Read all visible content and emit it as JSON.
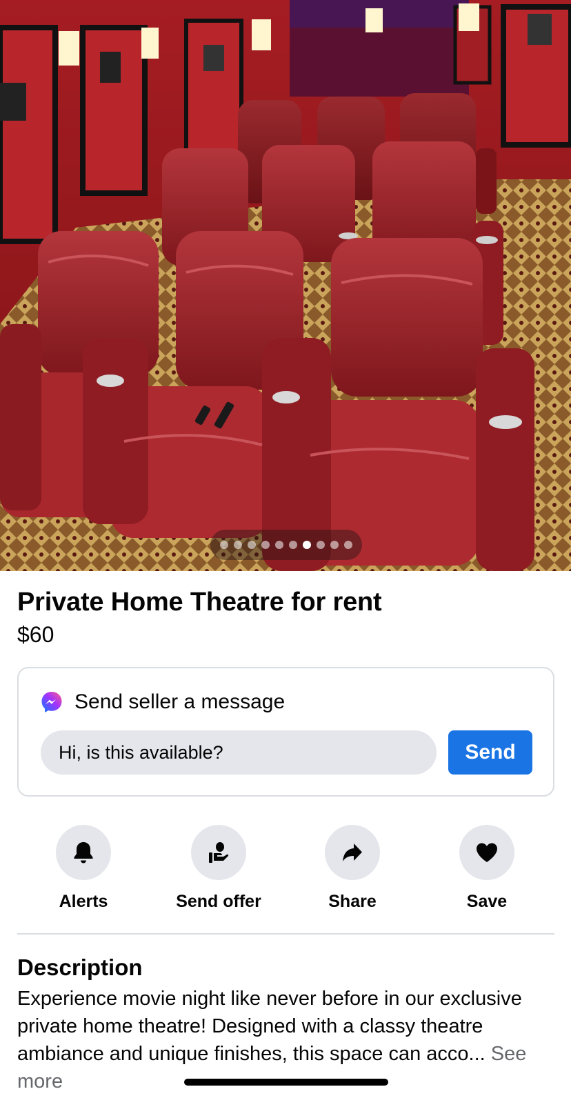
{
  "listing": {
    "title": "Private Home Theatre for rent",
    "price": "$60",
    "photo": {
      "description_icon": "theater-seats-photo",
      "carousel_total": 10,
      "carousel_active_index": 6
    }
  },
  "message_card": {
    "heading": "Send seller a message",
    "input_value": "Hi, is this available?",
    "send_label": "Send",
    "icon": "messenger-icon"
  },
  "actions": [
    {
      "label": "Alerts",
      "icon": "bell-icon"
    },
    {
      "label": "Send offer",
      "icon": "offer-hand-icon"
    },
    {
      "label": "Share",
      "icon": "share-arrow-icon"
    },
    {
      "label": "Save",
      "icon": "heart-icon"
    }
  ],
  "description": {
    "heading": "Description",
    "text": "Experience movie night like never before in our exclusive private home theatre! Designed with a classy theatre ambiance and unique finishes, this space can acco...",
    "see_more": " See more"
  },
  "colors": {
    "accent": "#1b74e4",
    "chip_bg": "#e4e6eb",
    "secondary_text": "#65676b",
    "seat_red": "#9b1c22"
  }
}
